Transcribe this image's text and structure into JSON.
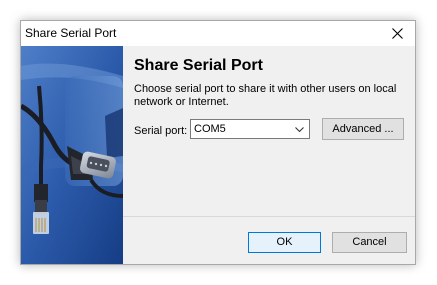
{
  "window": {
    "title": "Share Serial Port",
    "close_icon": "close-icon"
  },
  "main": {
    "heading": "Share Serial Port",
    "description": "Choose serial port to share it with other users on local network or Internet.",
    "serial_port_label": "Serial port:",
    "serial_port_value": "COM5",
    "advanced_label": "Advanced ...",
    "ok_label": "OK",
    "cancel_label": "Cancel"
  },
  "colors": {
    "banner_blue": "#1f4f9e",
    "ok_border": "#0078d7",
    "dialog_bg": "#f0f0f0"
  }
}
